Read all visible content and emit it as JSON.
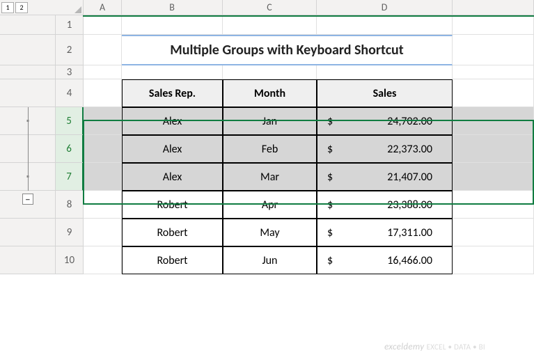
{
  "outline": {
    "levels": [
      "1",
      "2"
    ],
    "collapse_label": "−"
  },
  "columns": [
    "A",
    "B",
    "C",
    "D"
  ],
  "rows": [
    "1",
    "2",
    "3",
    "4",
    "5",
    "6",
    "7",
    "8",
    "9",
    "10"
  ],
  "title": "Multiple Groups with Keyboard Shortcut",
  "headers": {
    "rep": "Sales Rep.",
    "month": "Month",
    "sales": "Sales"
  },
  "data": [
    {
      "rep": "Alex",
      "month": "Jan",
      "currency": "$",
      "sales": "24,702.00"
    },
    {
      "rep": "Alex",
      "month": "Feb",
      "currency": "$",
      "sales": "22,373.00"
    },
    {
      "rep": "Alex",
      "month": "Mar",
      "currency": "$",
      "sales": "21,407.00"
    },
    {
      "rep": "Robert",
      "month": "Apr",
      "currency": "$",
      "sales": "23,388.00"
    },
    {
      "rep": "Robert",
      "month": "May",
      "currency": "$",
      "sales": "17,311.00"
    },
    {
      "rep": "Robert",
      "month": "Jun",
      "currency": "$",
      "sales": "16,466.00"
    }
  ],
  "watermark": "exceldemy",
  "chart_data": {
    "type": "table",
    "title": "Multiple Groups with Keyboard Shortcut",
    "columns": [
      "Sales Rep.",
      "Month",
      "Sales"
    ],
    "rows": [
      [
        "Alex",
        "Jan",
        24702.0
      ],
      [
        "Alex",
        "Feb",
        22373.0
      ],
      [
        "Alex",
        "Mar",
        21407.0
      ],
      [
        "Robert",
        "Apr",
        23388.0
      ],
      [
        "Robert",
        "May",
        17311.0
      ],
      [
        "Robert",
        "Jun",
        16466.0
      ]
    ]
  }
}
